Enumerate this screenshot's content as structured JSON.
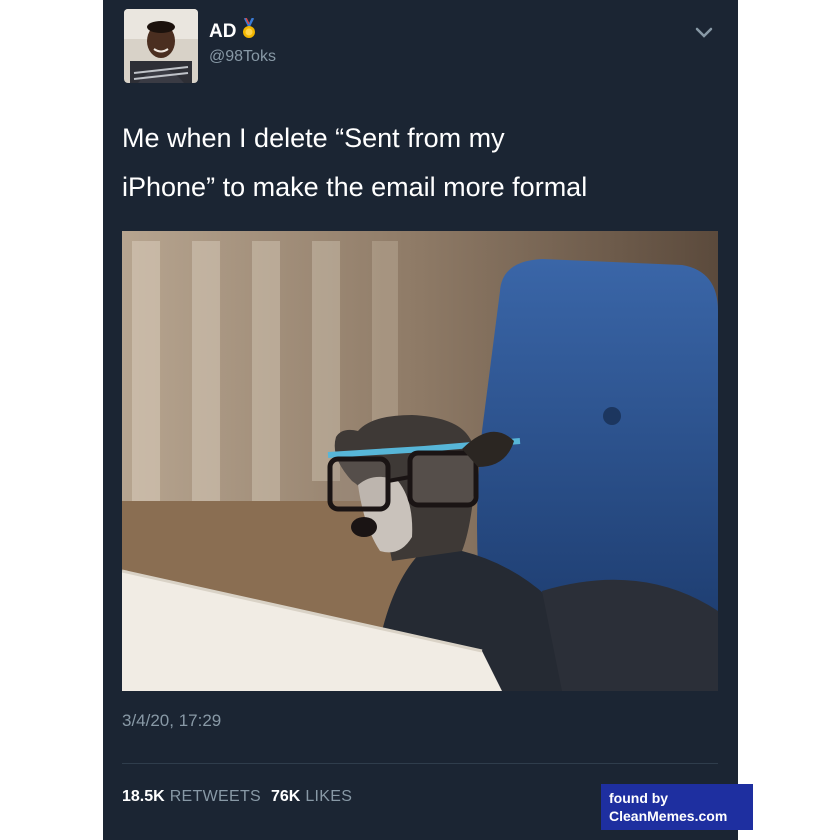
{
  "author": {
    "name": "AD",
    "handle": "@98Toks",
    "badge_icon": "medal-icon"
  },
  "menu_icon": "chevron-down-icon",
  "tweet": {
    "line1": "Me when I delete “Sent from my",
    "line2": "iPhone” to make the email more formal",
    "image_alt": "dog wearing glasses and turtleneck"
  },
  "timestamp": "3/4/20, 17:29",
  "stats": {
    "retweets_count": "18.5K",
    "retweets_label": "RETWEETS",
    "likes_count": "76K",
    "likes_label": "LIKES"
  },
  "watermark": {
    "line1": "found by",
    "line2": "CleanMemes.com"
  },
  "colors": {
    "card_bg": "#1b2533",
    "muted_text": "#8899a6",
    "watermark_bg": "#1e2fa0"
  }
}
